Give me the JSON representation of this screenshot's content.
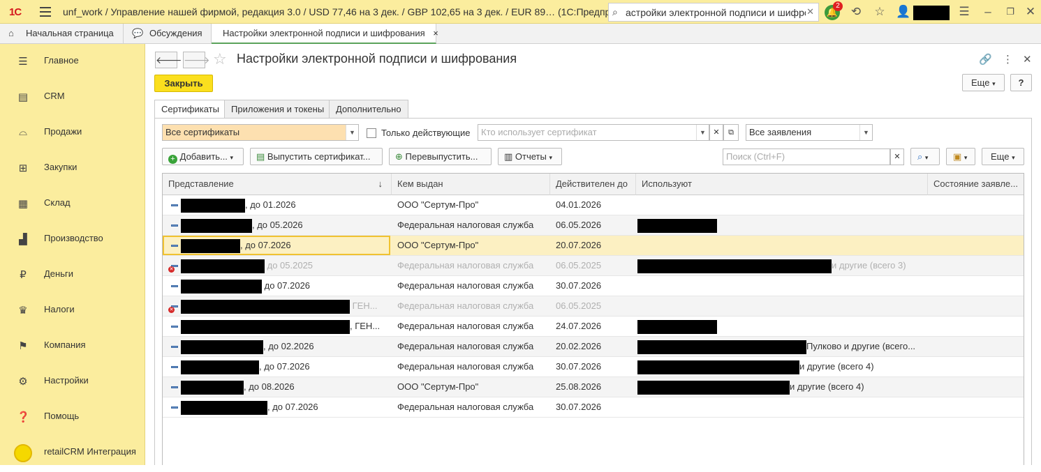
{
  "titlebar": {
    "logo": "1С",
    "title": "unf_work / Управление нашей фирмой, редакция 3.0 / USD 77,46 на 3 дек. / GBP 102,65 на 3 дек. / EUR 89…  (1С:Предприятие)",
    "search_value": "астройки электронной подписи и шифрова",
    "notification_count": "2"
  },
  "tabs": [
    {
      "label": "Начальная страница"
    },
    {
      "label": "Обсуждения"
    },
    {
      "label": "Настройки электронной подписи и шифрования",
      "close": "×"
    }
  ],
  "sidebar": [
    {
      "label": "Главное",
      "icon": "menu-icon"
    },
    {
      "label": "CRM",
      "icon": "crm-icon"
    },
    {
      "label": "Продажи",
      "icon": "basket-icon"
    },
    {
      "label": "Закупки",
      "icon": "cart-icon"
    },
    {
      "label": "Склад",
      "icon": "warehouse-icon"
    },
    {
      "label": "Производство",
      "icon": "factory-icon"
    },
    {
      "label": "Деньги",
      "icon": "ruble-icon"
    },
    {
      "label": "Налоги",
      "icon": "eagle-icon"
    },
    {
      "label": "Компания",
      "icon": "flag-icon"
    },
    {
      "label": "Настройки",
      "icon": "gear-icon"
    },
    {
      "label": "Помощь",
      "icon": "help-icon"
    },
    {
      "label": "retailCRM Интеграция",
      "icon": "retailcrm-icon"
    }
  ],
  "page": {
    "title": "Настройки электронной подписи и шифрования",
    "close_label": "Закрыть",
    "more_label": "Еще",
    "help_label": "?"
  },
  "form_tabs": [
    {
      "label": "Сертификаты"
    },
    {
      "label": "Приложения и токены"
    },
    {
      "label": "Дополнительно"
    }
  ],
  "filters": {
    "cert_filter": "Все сертификаты",
    "only_valid_label": "Только действующие",
    "who_uses_placeholder": "Кто использует сертификат",
    "applications_filter": "Все заявления"
  },
  "toolbar": {
    "add_label": "Добавить...",
    "issue_label": "Выпустить сертификат...",
    "reissue_label": "Перевыпустить...",
    "reports_label": "Отчеты",
    "search_placeholder": "Поиск (Ctrl+F)",
    "more_label": "Еще"
  },
  "grid": {
    "columns": [
      "Представление",
      "Кем выдан",
      "Действителен до",
      "Используют",
      "Состояние заявле..."
    ],
    "sort_arrow": "↓",
    "rows": [
      {
        "pres": ", до 01.2026",
        "issuer": "ООО \"Сертум-Про\"",
        "valid": "04.01.2026",
        "uses": "",
        "state": ""
      },
      {
        "pres": ", до 05.2026",
        "issuer": "Федеральная налоговая служба",
        "valid": "06.05.2026",
        "uses": "",
        "state": ""
      },
      {
        "pres": ", до 07.2026",
        "issuer": "ООО \"Сертум-Про\"",
        "valid": "20.07.2026",
        "uses": "",
        "state": ""
      },
      {
        "pres": " до 05.2025",
        "issuer": "Федеральная налоговая служба",
        "valid": "06.05.2025",
        "uses": "и другие (всего 3)",
        "state": ""
      },
      {
        "pres": " до 07.2026",
        "issuer": "Федеральная налоговая служба",
        "valid": "30.07.2026",
        "uses": "",
        "state": ""
      },
      {
        "pres": " ГЕН...",
        "issuer": "Федеральная налоговая служба",
        "valid": "06.05.2025",
        "uses": "",
        "state": ""
      },
      {
        "pres": ", ГЕН...",
        "issuer": "Федеральная налоговая служба",
        "valid": "24.07.2026",
        "uses": "",
        "state": ""
      },
      {
        "pres": ", до 02.2026",
        "issuer": "Федеральная налоговая служба",
        "valid": "20.02.2026",
        "uses": "Пулково и другие (всего...",
        "state": ""
      },
      {
        "pres": ", до 07.2026",
        "issuer": "Федеральная налоговая служба",
        "valid": "30.07.2026",
        "uses": "и другие (всего 4)",
        "state": ""
      },
      {
        "pres": ", до 08.2026",
        "issuer": "ООО \"Сертум-Про\"",
        "valid": "25.08.2026",
        "uses": "и другие (всего 4)",
        "state": ""
      },
      {
        "pres": ", до 07.2026",
        "issuer": "Федеральная налоговая служба",
        "valid": "30.07.2026",
        "uses": "",
        "state": ""
      }
    ]
  }
}
